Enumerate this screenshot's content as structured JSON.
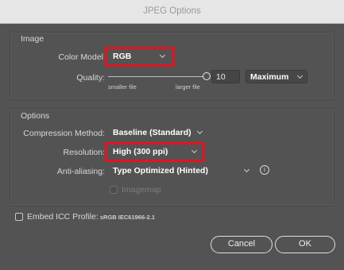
{
  "window": {
    "title": "JPEG Options"
  },
  "image_group": {
    "label": "Image",
    "color_model_label": "Color Model",
    "color_model_value": "RGB",
    "quality_label": "Quality:",
    "quality_small_label": "smaller file",
    "quality_large_label": "larger file",
    "quality_value": "10",
    "quality_level": 1.0,
    "quality_preset": "Maximum"
  },
  "options_group": {
    "label": "Options",
    "compression_label": "Compression Method:",
    "compression_value": "Baseline (Standard)",
    "resolution_label": "Resolution:",
    "resolution_value": "High (300 ppi)",
    "antialiasing_label": "Anti-aliasing:",
    "antialiasing_value": "Type Optimized (Hinted)",
    "info_icon": "info-icon",
    "info_glyph": "i",
    "imagemap_label": "Imagemap"
  },
  "embed_icc": {
    "label": "Embed ICC Profile:",
    "profile": "sRGB IEC61966-2.1"
  },
  "buttons": {
    "cancel": "Cancel",
    "ok": "OK"
  },
  "colors": {
    "highlight": "#e4131f",
    "background": "#535353"
  }
}
